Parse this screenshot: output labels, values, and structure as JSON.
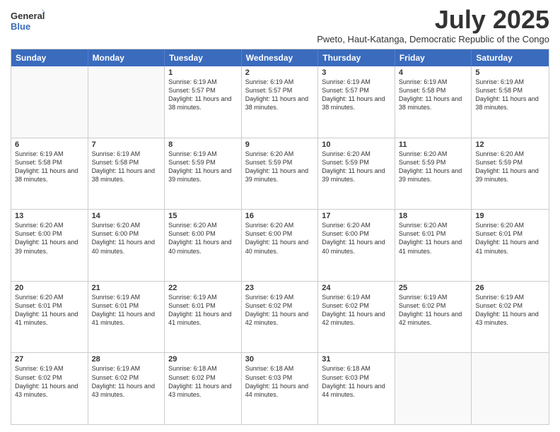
{
  "logo": {
    "line1": "General",
    "line2": "Blue"
  },
  "title": "July 2025",
  "location": "Pweto, Haut-Katanga, Democratic Republic of the Congo",
  "days_header": [
    "Sunday",
    "Monday",
    "Tuesday",
    "Wednesday",
    "Thursday",
    "Friday",
    "Saturday"
  ],
  "weeks": [
    [
      {
        "day": "",
        "info": ""
      },
      {
        "day": "",
        "info": ""
      },
      {
        "day": "1",
        "info": "Sunrise: 6:19 AM\nSunset: 5:57 PM\nDaylight: 11 hours and 38 minutes."
      },
      {
        "day": "2",
        "info": "Sunrise: 6:19 AM\nSunset: 5:57 PM\nDaylight: 11 hours and 38 minutes."
      },
      {
        "day": "3",
        "info": "Sunrise: 6:19 AM\nSunset: 5:57 PM\nDaylight: 11 hours and 38 minutes."
      },
      {
        "day": "4",
        "info": "Sunrise: 6:19 AM\nSunset: 5:58 PM\nDaylight: 11 hours and 38 minutes."
      },
      {
        "day": "5",
        "info": "Sunrise: 6:19 AM\nSunset: 5:58 PM\nDaylight: 11 hours and 38 minutes."
      }
    ],
    [
      {
        "day": "6",
        "info": "Sunrise: 6:19 AM\nSunset: 5:58 PM\nDaylight: 11 hours and 38 minutes."
      },
      {
        "day": "7",
        "info": "Sunrise: 6:19 AM\nSunset: 5:58 PM\nDaylight: 11 hours and 38 minutes."
      },
      {
        "day": "8",
        "info": "Sunrise: 6:19 AM\nSunset: 5:59 PM\nDaylight: 11 hours and 39 minutes."
      },
      {
        "day": "9",
        "info": "Sunrise: 6:20 AM\nSunset: 5:59 PM\nDaylight: 11 hours and 39 minutes."
      },
      {
        "day": "10",
        "info": "Sunrise: 6:20 AM\nSunset: 5:59 PM\nDaylight: 11 hours and 39 minutes."
      },
      {
        "day": "11",
        "info": "Sunrise: 6:20 AM\nSunset: 5:59 PM\nDaylight: 11 hours and 39 minutes."
      },
      {
        "day": "12",
        "info": "Sunrise: 6:20 AM\nSunset: 5:59 PM\nDaylight: 11 hours and 39 minutes."
      }
    ],
    [
      {
        "day": "13",
        "info": "Sunrise: 6:20 AM\nSunset: 6:00 PM\nDaylight: 11 hours and 39 minutes."
      },
      {
        "day": "14",
        "info": "Sunrise: 6:20 AM\nSunset: 6:00 PM\nDaylight: 11 hours and 40 minutes."
      },
      {
        "day": "15",
        "info": "Sunrise: 6:20 AM\nSunset: 6:00 PM\nDaylight: 11 hours and 40 minutes."
      },
      {
        "day": "16",
        "info": "Sunrise: 6:20 AM\nSunset: 6:00 PM\nDaylight: 11 hours and 40 minutes."
      },
      {
        "day": "17",
        "info": "Sunrise: 6:20 AM\nSunset: 6:00 PM\nDaylight: 11 hours and 40 minutes."
      },
      {
        "day": "18",
        "info": "Sunrise: 6:20 AM\nSunset: 6:01 PM\nDaylight: 11 hours and 41 minutes."
      },
      {
        "day": "19",
        "info": "Sunrise: 6:20 AM\nSunset: 6:01 PM\nDaylight: 11 hours and 41 minutes."
      }
    ],
    [
      {
        "day": "20",
        "info": "Sunrise: 6:20 AM\nSunset: 6:01 PM\nDaylight: 11 hours and 41 minutes."
      },
      {
        "day": "21",
        "info": "Sunrise: 6:19 AM\nSunset: 6:01 PM\nDaylight: 11 hours and 41 minutes."
      },
      {
        "day": "22",
        "info": "Sunrise: 6:19 AM\nSunset: 6:01 PM\nDaylight: 11 hours and 41 minutes."
      },
      {
        "day": "23",
        "info": "Sunrise: 6:19 AM\nSunset: 6:02 PM\nDaylight: 11 hours and 42 minutes."
      },
      {
        "day": "24",
        "info": "Sunrise: 6:19 AM\nSunset: 6:02 PM\nDaylight: 11 hours and 42 minutes."
      },
      {
        "day": "25",
        "info": "Sunrise: 6:19 AM\nSunset: 6:02 PM\nDaylight: 11 hours and 42 minutes."
      },
      {
        "day": "26",
        "info": "Sunrise: 6:19 AM\nSunset: 6:02 PM\nDaylight: 11 hours and 43 minutes."
      }
    ],
    [
      {
        "day": "27",
        "info": "Sunrise: 6:19 AM\nSunset: 6:02 PM\nDaylight: 11 hours and 43 minutes."
      },
      {
        "day": "28",
        "info": "Sunrise: 6:19 AM\nSunset: 6:02 PM\nDaylight: 11 hours and 43 minutes."
      },
      {
        "day": "29",
        "info": "Sunrise: 6:18 AM\nSunset: 6:02 PM\nDaylight: 11 hours and 43 minutes."
      },
      {
        "day": "30",
        "info": "Sunrise: 6:18 AM\nSunset: 6:03 PM\nDaylight: 11 hours and 44 minutes."
      },
      {
        "day": "31",
        "info": "Sunrise: 6:18 AM\nSunset: 6:03 PM\nDaylight: 11 hours and 44 minutes."
      },
      {
        "day": "",
        "info": ""
      },
      {
        "day": "",
        "info": ""
      }
    ]
  ]
}
